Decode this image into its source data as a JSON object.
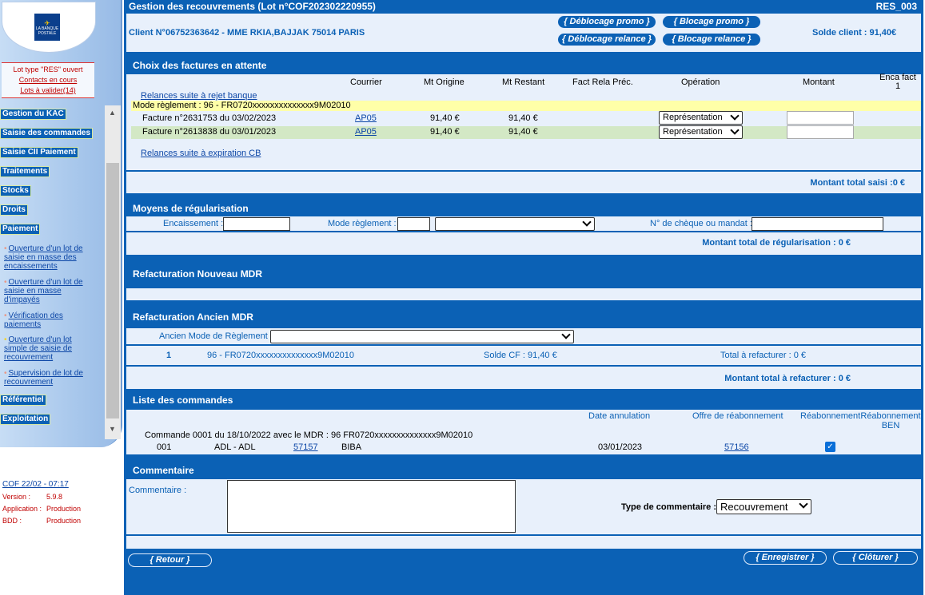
{
  "nav": {
    "logo_text": "LA BANQUE POSTALE",
    "lot_status": "Lot type \"RES\" ouvert",
    "contacts": "Contacts en cours",
    "lots_a_valider": "Lots à valider(14)",
    "items": [
      "Gestion du KAC",
      "Saisie des commandes",
      "Saisie CII Paiement",
      "Traitements",
      "Stocks",
      "Droits",
      "Paiement"
    ],
    "sub_items": [
      "Ouverture d'un lot de saisie en masse des encaissements",
      "Ouverture d'un lot de saisie en masse d'impayés",
      "Vérification des paiements",
      "Ouverture d'un lot simple de saisie de recouvrement",
      "Supervision de lot de recouvrement"
    ],
    "items_bottom": [
      "Référentiel",
      "Exploitation"
    ],
    "sys": {
      "cof": "COF 22/02 - 07:17",
      "version_label": "Version :",
      "version": "5.9.8",
      "application_label": "Application :",
      "application": "Production",
      "bdd_label": "BDD :",
      "bdd": "Production"
    }
  },
  "header": {
    "title": "Gestion des recouvrements (Lot n°COF202302220955)",
    "code": "RES_003",
    "client": "Client N°06752363642 - MME RKIA,BAJJAK 75014 PARIS",
    "solde": "Solde client : 91,40€",
    "btn_deblocage_promo": "{ Déblocage promo }",
    "btn_blocage_promo": "{ Blocage promo }",
    "btn_deblocage_relance": "{ Déblocage relance }",
    "btn_blocage_relance": "{ Blocage relance }"
  },
  "factures": {
    "title": "Choix des factures en attente",
    "columns": [
      "Courrier",
      "Mt Origine",
      "Mt Restant",
      "Fact Rela Préc.",
      "Opération",
      "Montant",
      "Enca fact",
      "1"
    ],
    "relances_rejet": "Relances suite à rejet banque",
    "mode_reglement": "Mode règlement : 96 - FR0720xxxxxxxxxxxxxx9M02010",
    "rows": [
      {
        "label": "Facture n°2631753 du 03/02/2023",
        "courrier": "AP05",
        "origine": "91,40 €",
        "restant": "91,40 €",
        "operation": "Représentation"
      },
      {
        "label": "Facture n°2613838 du 03/01/2023",
        "courrier": "AP05",
        "origine": "91,40 €",
        "restant": "91,40 €",
        "operation": "Représentation"
      }
    ],
    "relances_cb": "Relances suite à expiration CB",
    "total": "Montant total saisi :0 €"
  },
  "moyens": {
    "title": "Moyens de régularisation",
    "encaissement": "Encaissement :",
    "mode": "Mode règlement :",
    "cheque": "N° de chèque ou mandat :",
    "total": "Montant total de régularisation : 0 €"
  },
  "refact_nouveau": {
    "title": "Refacturation Nouveau MDR"
  },
  "refact_ancien": {
    "title": "Refacturation Ancien MDR",
    "ancien_mode": "Ancien Mode de Règlement :",
    "row_num": "1",
    "row_mdr": "96 - FR0720xxxxxxxxxxxxxx9M02010",
    "row_solde": "Solde CF : 91,40 €",
    "row_total": "Total à refacturer : 0 €",
    "total": "Montant total à refacturer : 0 €"
  },
  "commandes": {
    "title": "Liste des commandes",
    "col_date": "Date annulation",
    "col_offre": "Offre de réabonnement",
    "col_reab": "Réabonnement",
    "col_reab_ben": "Réabonnement BEN",
    "cmd_label": "Commande 0001 du 18/10/2022 avec le MDR : 96 FR0720xxxxxxxxxxxxxx9M02010",
    "row": {
      "num": "001",
      "produit": "ADL - ADL",
      "code": "57157",
      "nom": "BIBA",
      "date": "03/01/2023",
      "offre": "57156",
      "check": "✓"
    }
  },
  "commentaire": {
    "title": "Commentaire",
    "label": "Commentaire :",
    "type_label": "Type de commentaire :",
    "type_value": "Recouvrement"
  },
  "footer": {
    "retour": "{ Retour }",
    "enregistrer": "{ Enregistrer }",
    "cloturer": "{ Clôturer }"
  }
}
